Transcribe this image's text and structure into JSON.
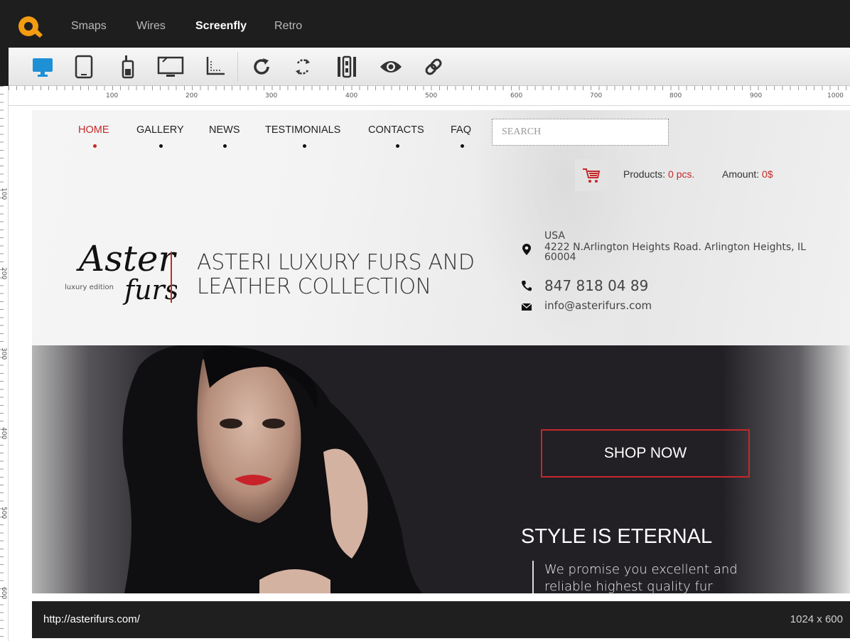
{
  "app": {
    "tabs": [
      {
        "label": "Smaps",
        "active": false
      },
      {
        "label": "Wires",
        "active": false
      },
      {
        "label": "Screenfly",
        "active": true
      },
      {
        "label": "Retro",
        "active": false
      }
    ],
    "brand_color": "#f39c12"
  },
  "toolbar": {
    "tools": [
      "desktop-icon",
      "tablet-icon",
      "mobile-icon",
      "tv-icon",
      "custom-size-icon",
      "rotate-icon",
      "refresh-icon",
      "scroll-icon",
      "preview-icon",
      "link-icon"
    ],
    "active_tool": "desktop-icon",
    "active_color": "#1e90d6"
  },
  "rulers": {
    "horizontal": [
      "100",
      "200",
      "300",
      "400",
      "500",
      "600",
      "700",
      "800",
      "900",
      "1000"
    ],
    "vertical": [
      "100",
      "200",
      "300",
      "400",
      "500",
      "600"
    ]
  },
  "site": {
    "nav": [
      "HOME",
      "GALLERY",
      "NEWS",
      "TESTIMONIALS",
      "CONTACTS",
      "FAQ"
    ],
    "search_placeholder": "SEARCH",
    "cart": {
      "products_label": "Products:",
      "products_value": "0 pcs.",
      "amount_label": "Amount:",
      "amount_value": "0$"
    },
    "logo": {
      "script": "Asteri",
      "script2": "furs",
      "small": "luxury edition"
    },
    "title": "ASTERI LUXURY FURS AND LEATHER COLLECTION",
    "contact": {
      "country": "USA",
      "address": "4222 N.Arlington Heights Road. Arlington Heights, IL 60004",
      "phone": "847 818 04 89",
      "email": "info@asterifurs.com"
    },
    "hero": {
      "cta": "SHOP NOW",
      "heading": "STYLE IS ETERNAL",
      "text": "We promise you excellent and reliable highest quality fur"
    },
    "accent_color": "#c62828"
  },
  "status": {
    "url": "http://asterifurs.com/",
    "size": "1024 x 600"
  }
}
